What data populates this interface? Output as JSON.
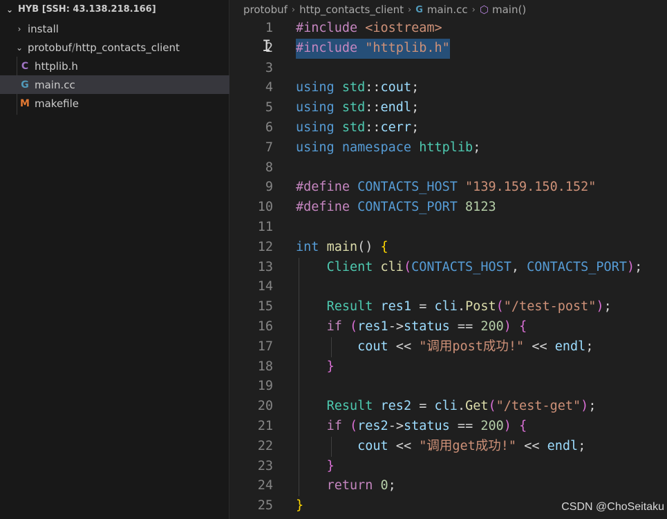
{
  "sidebar": {
    "title": "HYB [SSH: 43.138.218.166]",
    "items": [
      {
        "label": "install",
        "kind": "folder",
        "expanded": false
      },
      {
        "label": "protobuf",
        "sep": "/",
        "label2": "http_contacts_client",
        "kind": "folder",
        "expanded": true
      },
      {
        "label": "httplib.h",
        "kind": "file",
        "icon": "C",
        "icon_color": "#a074c4"
      },
      {
        "label": "main.cc",
        "kind": "file",
        "icon": "G",
        "icon_color": "#519aba",
        "selected": true
      },
      {
        "label": "makefile",
        "kind": "file",
        "icon": "M",
        "icon_color": "#e37933"
      }
    ]
  },
  "breadcrumb": {
    "parts": [
      "protobuf",
      "http_contacts_client",
      "main.cc",
      "main()"
    ]
  },
  "editor": {
    "current_line": 2,
    "lines": [
      [
        [
          "#include ",
          "ctl"
        ],
        [
          "<iostream>",
          "str"
        ]
      ],
      [
        [
          "#include ",
          "ctl"
        ],
        [
          "\"httplib.h\"",
          "str"
        ]
      ],
      [],
      [
        [
          "using ",
          "kw"
        ],
        [
          "std",
          "ty"
        ],
        [
          "::",
          "op"
        ],
        [
          "cout",
          "var"
        ],
        [
          ";",
          "op"
        ]
      ],
      [
        [
          "using ",
          "kw"
        ],
        [
          "std",
          "ty"
        ],
        [
          "::",
          "op"
        ],
        [
          "endl",
          "var"
        ],
        [
          ";",
          "op"
        ]
      ],
      [
        [
          "using ",
          "kw"
        ],
        [
          "std",
          "ty"
        ],
        [
          "::",
          "op"
        ],
        [
          "cerr",
          "var"
        ],
        [
          ";",
          "op"
        ]
      ],
      [
        [
          "using ",
          "kw"
        ],
        [
          "namespace ",
          "kw"
        ],
        [
          "httplib",
          "ty"
        ],
        [
          ";",
          "op"
        ]
      ],
      [],
      [
        [
          "#define ",
          "ctl"
        ],
        [
          "CONTACTS_HOST ",
          "mac"
        ],
        [
          "\"139.159.150.152\"",
          "str"
        ]
      ],
      [
        [
          "#define ",
          "ctl"
        ],
        [
          "CONTACTS_PORT ",
          "mac"
        ],
        [
          "8123",
          "num"
        ]
      ],
      [],
      [
        [
          "int ",
          "kw"
        ],
        [
          "main",
          "fn"
        ],
        [
          "() ",
          "op"
        ],
        [
          "{",
          "br1"
        ]
      ],
      [
        [
          "    ",
          "op"
        ],
        [
          "Client ",
          "ty"
        ],
        [
          "cli",
          "fn"
        ],
        [
          "(",
          "br2"
        ],
        [
          "CONTACTS_HOST",
          "mac"
        ],
        [
          ", ",
          "op"
        ],
        [
          "CONTACTS_PORT",
          "mac"
        ],
        [
          ")",
          "br2"
        ],
        [
          ";",
          "op"
        ]
      ],
      [],
      [
        [
          "    ",
          "op"
        ],
        [
          "Result ",
          "ty"
        ],
        [
          "res1",
          "var"
        ],
        [
          " = ",
          "op"
        ],
        [
          "cli",
          "var"
        ],
        [
          ".",
          "op"
        ],
        [
          "Post",
          "fn"
        ],
        [
          "(",
          "br2"
        ],
        [
          "\"/test-post\"",
          "str"
        ],
        [
          ")",
          "br2"
        ],
        [
          ";",
          "op"
        ]
      ],
      [
        [
          "    ",
          "op"
        ],
        [
          "if ",
          "ctl"
        ],
        [
          "(",
          "br2"
        ],
        [
          "res1",
          "var"
        ],
        [
          "->",
          "op"
        ],
        [
          "status",
          "var"
        ],
        [
          " == ",
          "op"
        ],
        [
          "200",
          "num"
        ],
        [
          ") ",
          "br2"
        ],
        [
          "{",
          "br2"
        ]
      ],
      [
        [
          "        ",
          "op"
        ],
        [
          "cout",
          "var"
        ],
        [
          " << ",
          "op"
        ],
        [
          "\"调用post成功!\"",
          "str"
        ],
        [
          " << ",
          "op"
        ],
        [
          "endl",
          "var"
        ],
        [
          ";",
          "op"
        ]
      ],
      [
        [
          "    ",
          "op"
        ],
        [
          "}",
          "br2"
        ]
      ],
      [],
      [
        [
          "    ",
          "op"
        ],
        [
          "Result ",
          "ty"
        ],
        [
          "res2",
          "var"
        ],
        [
          " = ",
          "op"
        ],
        [
          "cli",
          "var"
        ],
        [
          ".",
          "op"
        ],
        [
          "Get",
          "fn"
        ],
        [
          "(",
          "br2"
        ],
        [
          "\"/test-get\"",
          "str"
        ],
        [
          ")",
          "br2"
        ],
        [
          ";",
          "op"
        ]
      ],
      [
        [
          "    ",
          "op"
        ],
        [
          "if ",
          "ctl"
        ],
        [
          "(",
          "br2"
        ],
        [
          "res2",
          "var"
        ],
        [
          "->",
          "op"
        ],
        [
          "status",
          "var"
        ],
        [
          " == ",
          "op"
        ],
        [
          "200",
          "num"
        ],
        [
          ") ",
          "br2"
        ],
        [
          "{",
          "br2"
        ]
      ],
      [
        [
          "        ",
          "op"
        ],
        [
          "cout",
          "var"
        ],
        [
          " << ",
          "op"
        ],
        [
          "\"调用get成功!\"",
          "str"
        ],
        [
          " << ",
          "op"
        ],
        [
          "endl",
          "var"
        ],
        [
          ";",
          "op"
        ]
      ],
      [
        [
          "    ",
          "op"
        ],
        [
          "}",
          "br2"
        ]
      ],
      [
        [
          "    ",
          "op"
        ],
        [
          "return ",
          "ctl"
        ],
        [
          "0",
          "num"
        ],
        [
          ";",
          "op"
        ]
      ],
      [
        [
          "}",
          "br1"
        ]
      ]
    ]
  },
  "watermark": "CSDN @ChoSeitaku"
}
